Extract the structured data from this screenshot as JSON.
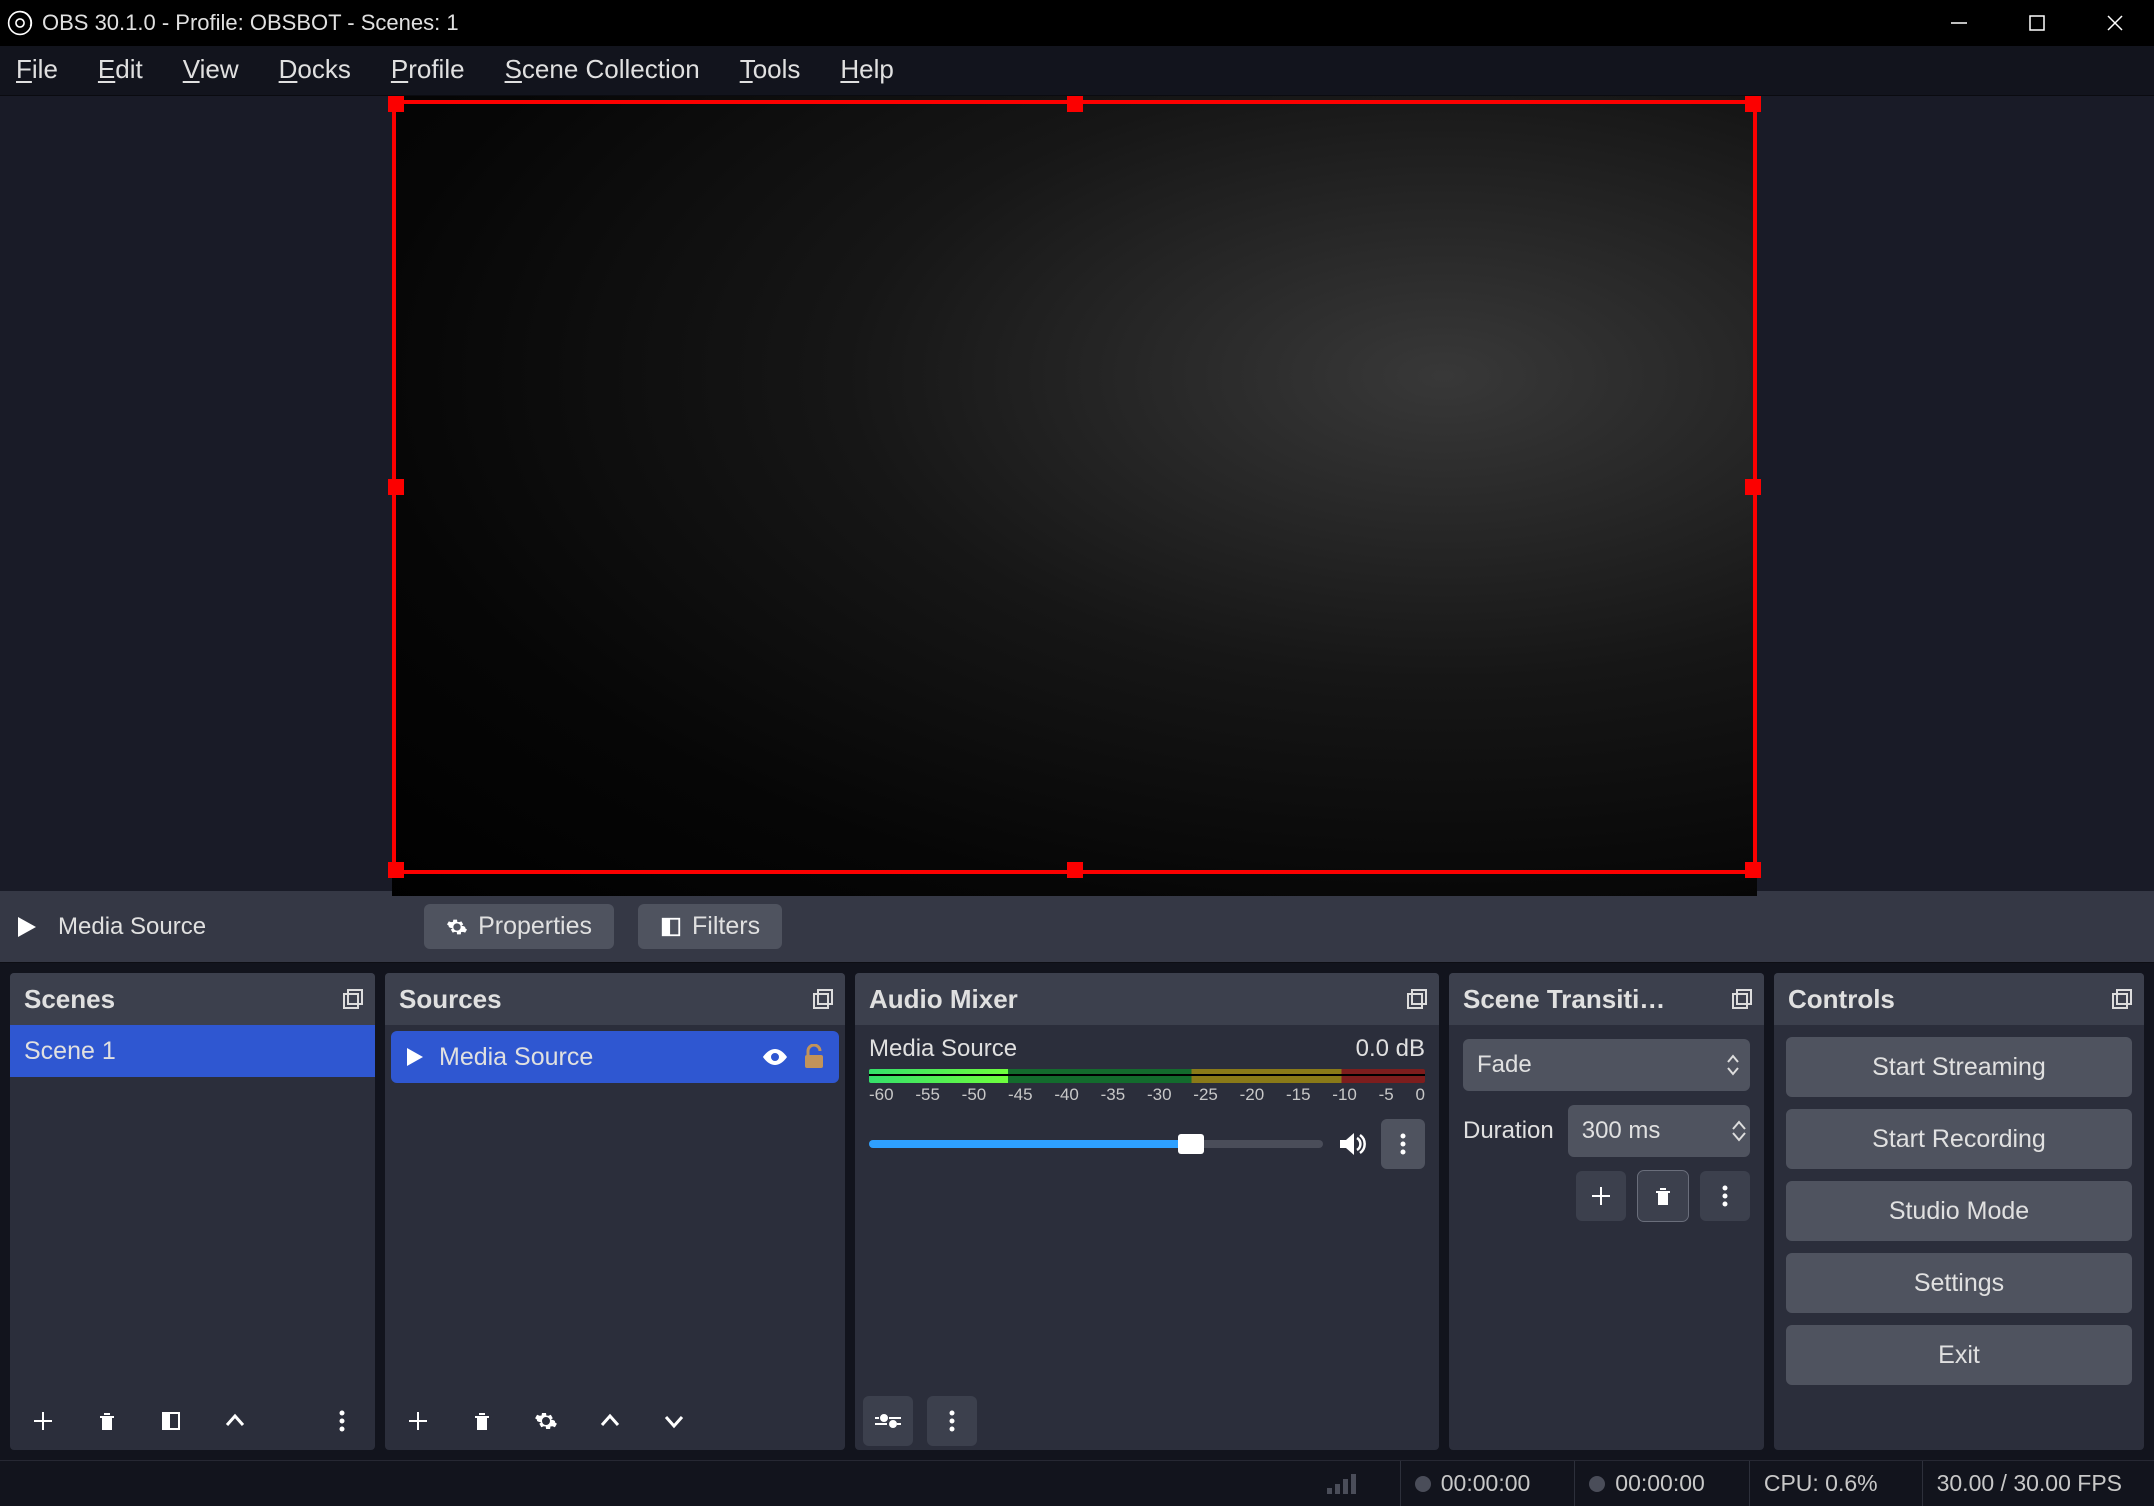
{
  "window": {
    "title": "OBS 30.1.0 - Profile: OBSBOT - Scenes: 1"
  },
  "menu": {
    "file": "File",
    "edit": "Edit",
    "view": "View",
    "docks": "Docks",
    "profile": "Profile",
    "scene_collection": "Scene Collection",
    "tools": "Tools",
    "help": "Help"
  },
  "source_toolbar": {
    "selected_name": "Media Source",
    "properties": "Properties",
    "filters": "Filters"
  },
  "panels": {
    "scenes": {
      "title": "Scenes",
      "items": [
        "Scene 1"
      ]
    },
    "sources": {
      "title": "Sources",
      "items": [
        {
          "name": "Media Source",
          "visible": true,
          "locked": false
        }
      ]
    },
    "mixer": {
      "title": "Audio Mixer",
      "tracks": [
        {
          "name": "Media Source",
          "level_db": "0.0 dB"
        }
      ],
      "scale_labels": [
        "-60",
        "-55",
        "-50",
        "-45",
        "-40",
        "-35",
        "-30",
        "-25",
        "-20",
        "-15",
        "-10",
        "-5",
        "0"
      ]
    },
    "transitions": {
      "title": "Scene Transiti…",
      "selected": "Fade",
      "duration_label": "Duration",
      "duration_value": "300 ms"
    },
    "controls": {
      "title": "Controls",
      "buttons": {
        "start_streaming": "Start Streaming",
        "start_recording": "Start Recording",
        "studio_mode": "Studio Mode",
        "settings": "Settings",
        "exit": "Exit"
      }
    }
  },
  "status": {
    "live_time": "00:00:00",
    "rec_time": "00:00:00",
    "cpu": "CPU: 0.6%",
    "fps": "30.00 / 30.00 FPS"
  }
}
